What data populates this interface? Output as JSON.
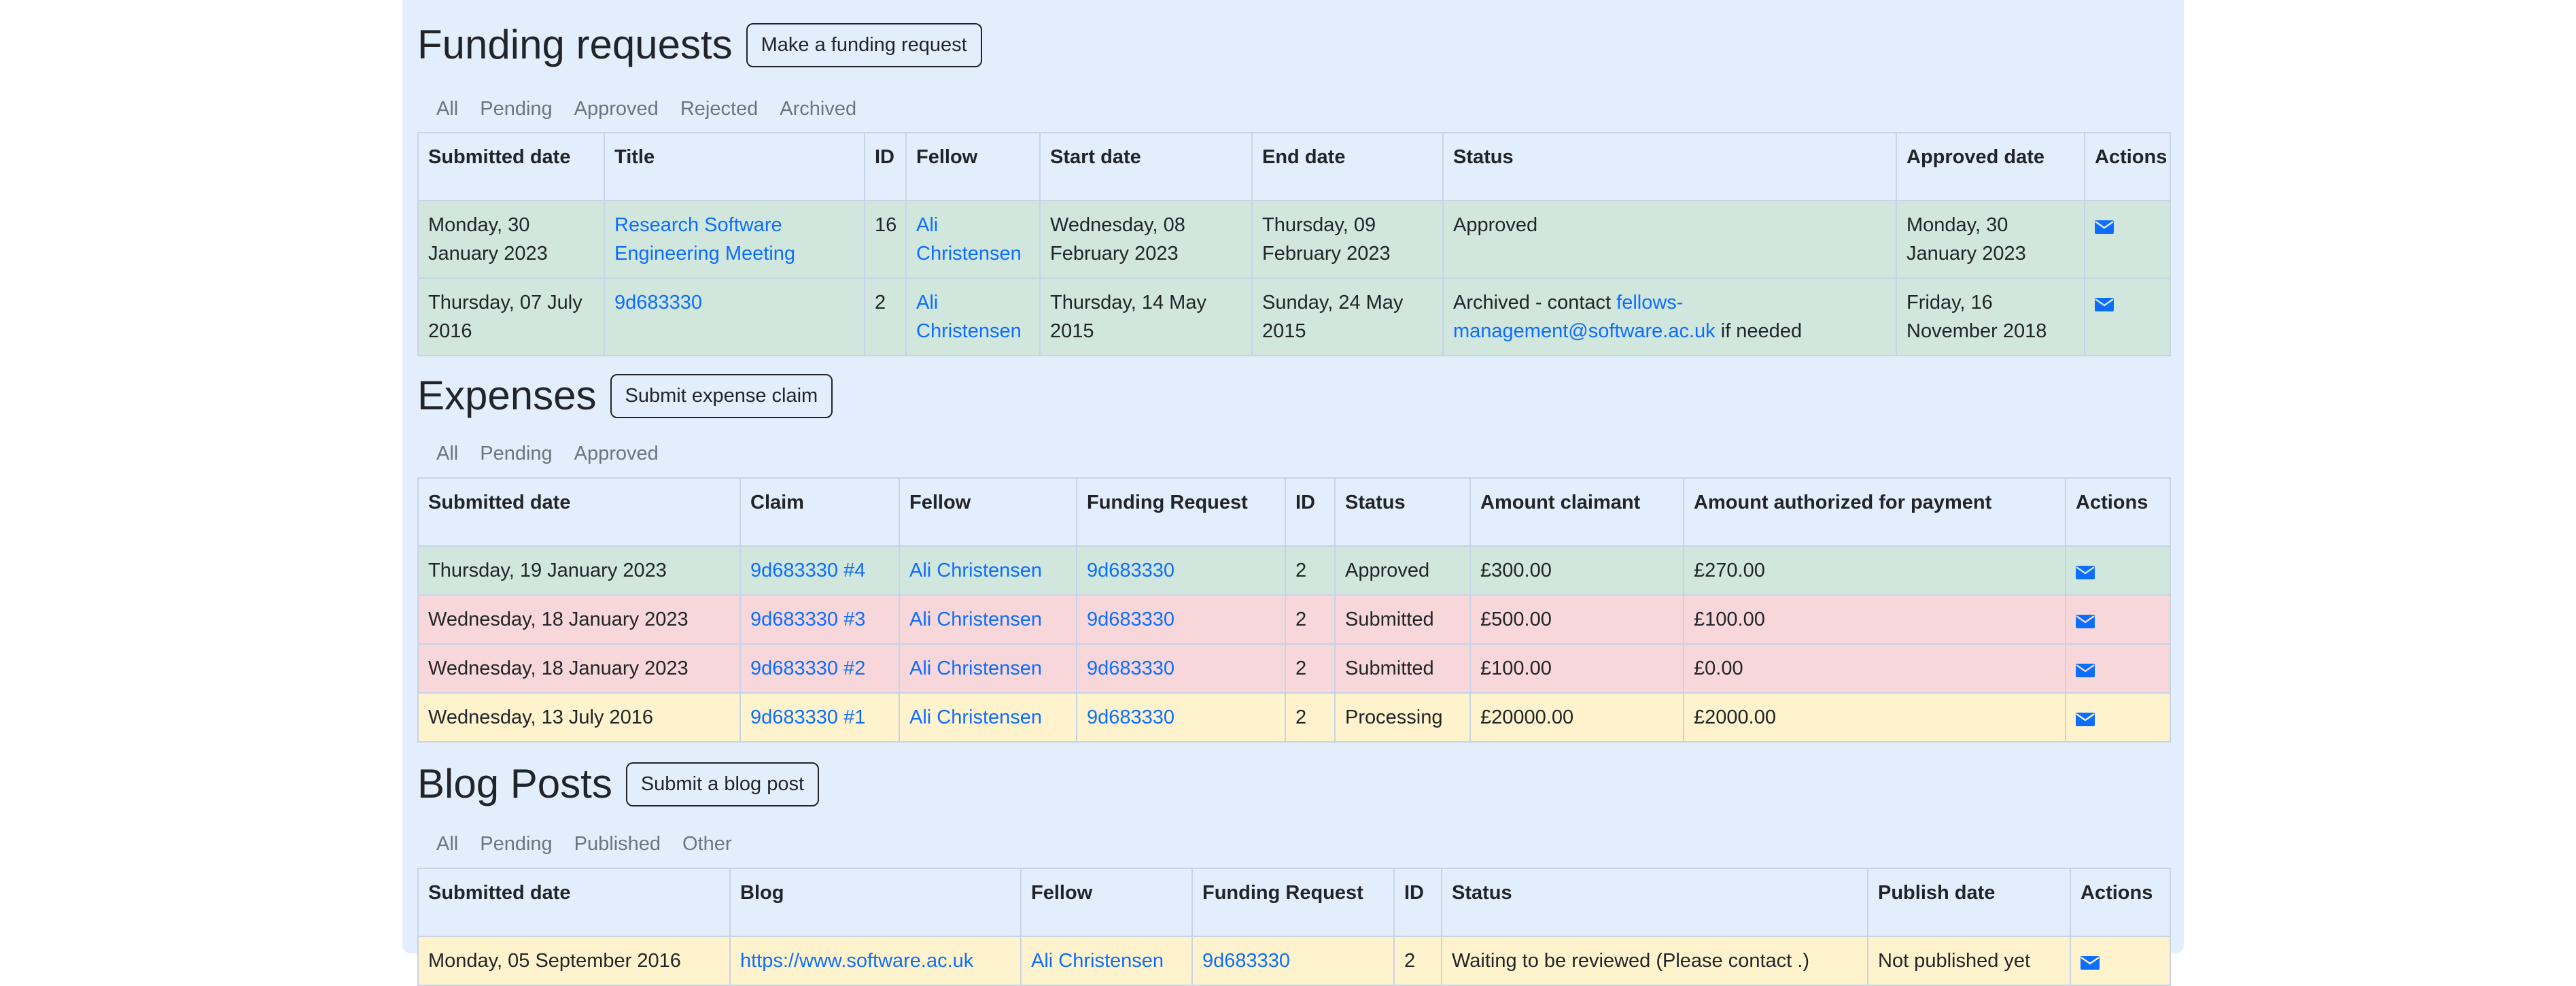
{
  "funding": {
    "title": "Funding requests",
    "button": "Make a funding request",
    "tabs": [
      "All",
      "Pending",
      "Approved",
      "Rejected",
      "Archived"
    ],
    "headers": [
      "Submitted date",
      "Title",
      "ID",
      "Fellow",
      "Start date",
      "End date",
      "Status",
      "Approved date",
      "Actions"
    ],
    "rows": [
      {
        "submitted": "Monday, 30 January 2023",
        "title": "Research Software Engineering Meeting",
        "id": "16",
        "fellow": "Ali Christensen",
        "start": "Wednesday, 08 February 2023",
        "end": "Thursday, 09 February 2023",
        "status_text": "Approved",
        "status_link": "",
        "status_suffix": "",
        "approved": "Monday, 30 January 2023"
      },
      {
        "submitted": "Thursday, 07 July 2016",
        "title": "9d683330",
        "id": "2",
        "fellow": "Ali Christensen",
        "start": "Thursday, 14 May 2015",
        "end": "Sunday, 24 May 2015",
        "status_text": "Archived - contact ",
        "status_link": "fellows-management@software.ac.uk",
        "status_suffix": " if needed",
        "approved": "Friday, 16 November 2018"
      }
    ]
  },
  "expenses": {
    "title": "Expenses",
    "button": "Submit expense claim",
    "tabs": [
      "All",
      "Pending",
      "Approved"
    ],
    "headers": [
      "Submitted date",
      "Claim",
      "Fellow",
      "Funding Request",
      "ID",
      "Status",
      "Amount claimant",
      "Amount authorized for payment",
      "Actions"
    ],
    "rows": [
      {
        "submitted": "Thursday, 19 January 2023",
        "claim": "9d683330 #4",
        "fellow": "Ali Christensen",
        "request": "9d683330",
        "id": "2",
        "status": "Approved",
        "claimed": "£300.00",
        "authorized": "£270.00"
      },
      {
        "submitted": "Wednesday, 18 January 2023",
        "claim": "9d683330 #3",
        "fellow": "Ali Christensen",
        "request": "9d683330",
        "id": "2",
        "status": "Submitted",
        "claimed": "£500.00",
        "authorized": "£100.00"
      },
      {
        "submitted": "Wednesday, 18 January 2023",
        "claim": "9d683330 #2",
        "fellow": "Ali Christensen",
        "request": "9d683330",
        "id": "2",
        "status": "Submitted",
        "claimed": "£100.00",
        "authorized": "£0.00"
      },
      {
        "submitted": "Wednesday, 13 July 2016",
        "claim": "9d683330 #1",
        "fellow": "Ali Christensen",
        "request": "9d683330",
        "id": "2",
        "status": "Processing",
        "claimed": "£20000.00",
        "authorized": "£2000.00"
      }
    ]
  },
  "blog": {
    "title": "Blog Posts",
    "button": "Submit a blog post",
    "tabs": [
      "All",
      "Pending",
      "Published",
      "Other"
    ],
    "headers": [
      "Submitted date",
      "Blog",
      "Fellow",
      "Funding Request",
      "ID",
      "Status",
      "Publish date",
      "Actions"
    ],
    "rows": [
      {
        "submitted": "Monday, 05 September 2016",
        "blog": "https://www.software.ac.uk",
        "fellow": "Ali Christensen",
        "request": "9d683330",
        "id": "2",
        "status": "Waiting to be reviewed (Please contact .)",
        "publish": "Not published yet"
      }
    ]
  },
  "colors": {
    "approved_row": "#d1e7dd",
    "submitted_row": "#f8d7da",
    "processing_row": "#fff3cd",
    "link": "#0d6efd",
    "panel": "#e3eefc"
  },
  "icons": {
    "action": "envelope-icon"
  }
}
